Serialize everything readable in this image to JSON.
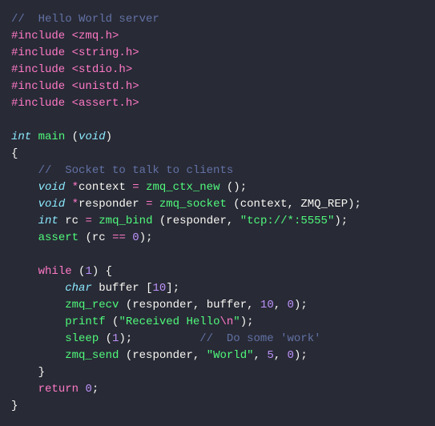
{
  "code": {
    "line1": {
      "c1": "//  Hello World server"
    },
    "line2": {
      "pre": "#include ",
      "arg": "<zmq.h>"
    },
    "line3": {
      "pre": "#include ",
      "arg": "<string.h>"
    },
    "line4": {
      "pre": "#include ",
      "arg": "<stdio.h>"
    },
    "line5": {
      "pre": "#include ",
      "arg": "<unistd.h>"
    },
    "line6": {
      "pre": "#include ",
      "arg": "<assert.h>"
    },
    "line8": {
      "type": "int",
      "sp": " ",
      "fn": "main",
      "sp2": " ",
      "lp": "(",
      "arg": "void",
      "rp": ")"
    },
    "line9": {
      "brace": "{"
    },
    "line10": {
      "indent": "    ",
      "c": "//  Socket to talk to clients"
    },
    "line11": {
      "indent": "    ",
      "type": "void",
      "sp": " ",
      "star": "*",
      "id": "context",
      "sp2": " ",
      "op": "=",
      "sp3": " ",
      "fn": "zmq_ctx_new",
      "sp4": " ",
      "lp": "(",
      "rp": ")",
      "semi": ";"
    },
    "line12": {
      "indent": "    ",
      "type": "void",
      "sp": " ",
      "star": "*",
      "id": "responder",
      "sp2": " ",
      "op": "=",
      "sp3": " ",
      "fn": "zmq_socket",
      "sp4": " ",
      "lp": "(",
      "a1": "context",
      "comma": ", ",
      "a2": "ZMQ_REP",
      "rp": ")",
      "semi": ";"
    },
    "line13": {
      "indent": "    ",
      "type": "int",
      "sp": " ",
      "id": "rc",
      "sp2": " ",
      "op": "=",
      "sp3": " ",
      "fn": "zmq_bind",
      "sp4": " ",
      "lp": "(",
      "a1": "responder",
      "comma": ", ",
      "str": "\"tcp://*:5555\"",
      "rp": ")",
      "semi": ";"
    },
    "line14": {
      "indent": "    ",
      "fn": "assert",
      "sp": " ",
      "lp": "(",
      "a1": "rc",
      "sp2": " ",
      "op": "==",
      "sp3": " ",
      "num": "0",
      "rp": ")",
      "semi": ";"
    },
    "line16": {
      "indent": "    ",
      "kw": "while",
      "sp": " ",
      "lp": "(",
      "num": "1",
      "rp": ")",
      "sp2": " ",
      "brace": "{"
    },
    "line17": {
      "indent": "        ",
      "type": "char",
      "sp": " ",
      "id": "buffer",
      "sp2": " ",
      "lb": "[",
      "num": "10",
      "rb": "]",
      "semi": ";"
    },
    "line18": {
      "indent": "        ",
      "fn": "zmq_recv",
      "sp": " ",
      "lp": "(",
      "a1": "responder",
      "c1": ", ",
      "a2": "buffer",
      "c2": ", ",
      "n1": "10",
      "c3": ", ",
      "n2": "0",
      "rp": ")",
      "semi": ";"
    },
    "line19": {
      "indent": "        ",
      "fn": "printf",
      "sp": " ",
      "lp": "(",
      "q1": "\"",
      "str": "Received Hello",
      "esc": "\\n",
      "q2": "\"",
      "rp": ")",
      "semi": ";"
    },
    "line20": {
      "indent": "        ",
      "fn": "sleep",
      "sp": " ",
      "lp": "(",
      "num": "1",
      "rp": ")",
      "semi": ";",
      "pad": "          ",
      "c": "//  Do some 'work'"
    },
    "line21": {
      "indent": "        ",
      "fn": "zmq_send",
      "sp": " ",
      "lp": "(",
      "a1": "responder",
      "c1": ", ",
      "str": "\"World\"",
      "c2": ", ",
      "n1": "5",
      "c3": ", ",
      "n2": "0",
      "rp": ")",
      "semi": ";"
    },
    "line22": {
      "indent": "    ",
      "brace": "}"
    },
    "line23": {
      "indent": "    ",
      "kw": "return",
      "sp": " ",
      "num": "0",
      "semi": ";"
    },
    "line24": {
      "brace": "}"
    }
  }
}
